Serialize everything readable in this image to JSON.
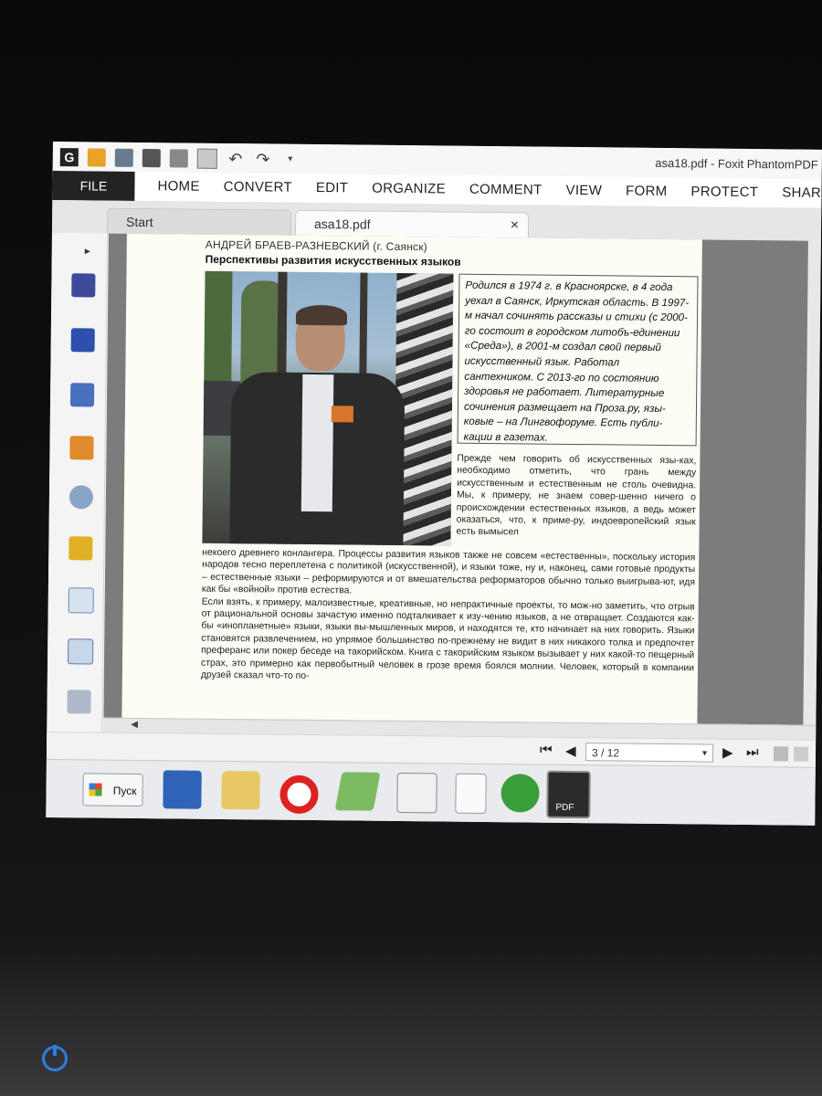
{
  "window": {
    "title": "asa18.pdf - Foxit PhantomPDF"
  },
  "menu": {
    "file": "FILE",
    "items": [
      "HOME",
      "CONVERT",
      "EDIT",
      "ORGANIZE",
      "COMMENT",
      "VIEW",
      "FORM",
      "PROTECT",
      "SHARE"
    ]
  },
  "tabs": {
    "start": "Start",
    "active": "asa18.pdf",
    "close": "×"
  },
  "nav": {
    "expand": "▸"
  },
  "page": {
    "author": "АНДРЕЙ БРАЕВ-РАЗНЕВСКИЙ (г. Саянск)",
    "headline": "Перспективы развития искусственных языков",
    "bio": "Родился в 1974 г. в Красноярске, в 4 года уехал в Саянск, Иркутская область. В 1997-м начал сочинять рассказы и стихи (с 2000-го состоит в городском литобъ-единении «Среда»), в 2001-м создал свой первый искусственный язык. Работал сантехником. С 2013-го по состоянию здоровья не работает. Литературные сочинения размещает на Проза.ру, язы-ковые – на Лингвофоруме. Есть публи-кации в газетах.",
    "body_right": "Прежде чем говорить об искусственных язы-ках, необходимо отметить, что грань между искусственным и естественным не столь очевидна. Мы, к примеру, не знаем совер-шенно ничего о происхождении естественных языков, а ведь может оказаться, что, к приме-ру, индоевропейский язык есть вымысел",
    "body_full_1": "некоего древнего конлангера. Процессы развития языков также не совсем «естественны», поскольку история народов тесно переплетена с политикой (искусственной), и языки тоже, ну и, наконец, сами готовые продукты – естественные языки – реформируются и от вмешательства реформаторов обычно только выигрыва-ют, идя как бы «войной» против естества.",
    "body_full_2": "Если взять, к примеру, малоизвестные, креативные, но непрактичные проекты, то мож-но заметить, что отрыв от рациональной основы зачастую именно подталкивает к изу-чению языков, а не отвращает. Создаются как-бы «инопланетные» языки, языки вы-мышленных миров, и находятся те, кто начинает на них говорить. Языки становятся развлечением, но упрямое большинство по-прежнему не видит в них никакого толка и предпочтет преферанс или покер беседе на такорийском. Книга с такорийским языком вызывает у них какой-то пещерный страх, это примерно как первобытный человек в грозе время боялся молнии. Человек, который в компании друзей сказал что-то по-"
  },
  "status": {
    "first": "⏮",
    "prev": "◀",
    "page_indicator": "3 / 12",
    "dropdown": "▾",
    "next": "▶",
    "last": "⏭"
  },
  "taskbar": {
    "start_label": "Пуск",
    "pdf_label": "PDF"
  },
  "colors": {
    "accent_blue": "#2e7de0",
    "file_tab": "#222222"
  }
}
